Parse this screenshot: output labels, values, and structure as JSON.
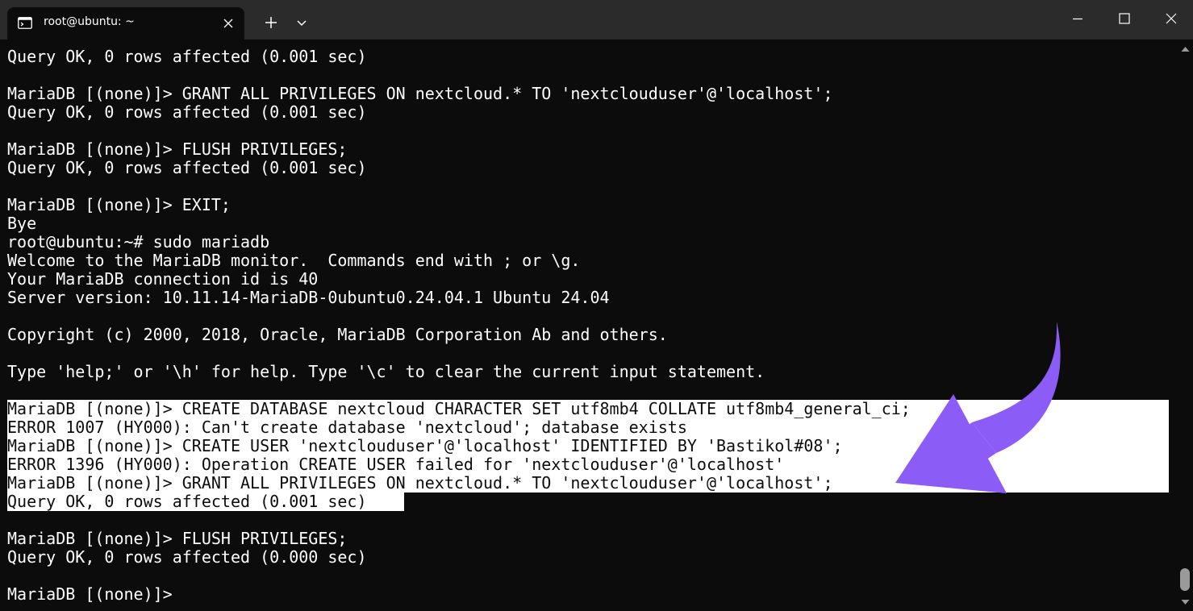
{
  "window": {
    "tab_title": "root@ubuntu: ~",
    "tab_icon": "terminal-icon",
    "buttons": {
      "close_tab": "close-icon",
      "new_tab": "plus-icon",
      "dropdown": "chevron-down-icon",
      "minimize": "minimize-icon",
      "maximize": "maximize-icon",
      "close": "close-icon"
    }
  },
  "terminal": {
    "lines": [
      "Query OK, 0 rows affected (0.001 sec)",
      "",
      "MariaDB [(none)]> GRANT ALL PRIVILEGES ON nextcloud.* TO 'nextclouduser'@'localhost';",
      "Query OK, 0 rows affected (0.001 sec)",
      "",
      "MariaDB [(none)]> FLUSH PRIVILEGES;",
      "Query OK, 0 rows affected (0.001 sec)",
      "",
      "MariaDB [(none)]> EXIT;",
      "Bye",
      "root@ubuntu:~# sudo mariadb",
      "Welcome to the MariaDB monitor.  Commands end with ; or \\g.",
      "Your MariaDB connection id is 40",
      "Server version: 10.11.14-MariaDB-0ubuntu0.24.04.1 Ubuntu 24.04",
      "",
      "Copyright (c) 2000, 2018, Oracle, MariaDB Corporation Ab and others.",
      "",
      "Type 'help;' or '\\h' for help. Type '\\c' to clear the current input statement.",
      "",
      "MariaDB [(none)]> CREATE DATABASE nextcloud CHARACTER SET utf8mb4 COLLATE utf8mb4_general_ci;",
      "ERROR 1007 (HY000): Can't create database 'nextcloud'; database exists",
      "MariaDB [(none)]> CREATE USER 'nextclouduser'@'localhost' IDENTIFIED BY 'Bastikol#08';",
      "ERROR 1396 (HY000): Operation CREATE USER failed for 'nextclouduser'@'localhost'",
      "MariaDB [(none)]> GRANT ALL PRIVILEGES ON nextcloud.* TO 'nextclouduser'@'localhost';",
      "Query OK, 0 rows affected (0.001 sec)",
      "",
      "MariaDB [(none)]> FLUSH PRIVILEGES;",
      "Query OK, 0 rows affected (0.000 sec)",
      "",
      "MariaDB [(none)]>"
    ]
  },
  "colors": {
    "background": "#0c0c0c",
    "titlebar": "#2b2b2b",
    "text": "#ffffff",
    "highlight": "#ffffff",
    "annotation_arrow": "#8b5cf6"
  },
  "annotation": {
    "icon": "curved-arrow-icon"
  }
}
